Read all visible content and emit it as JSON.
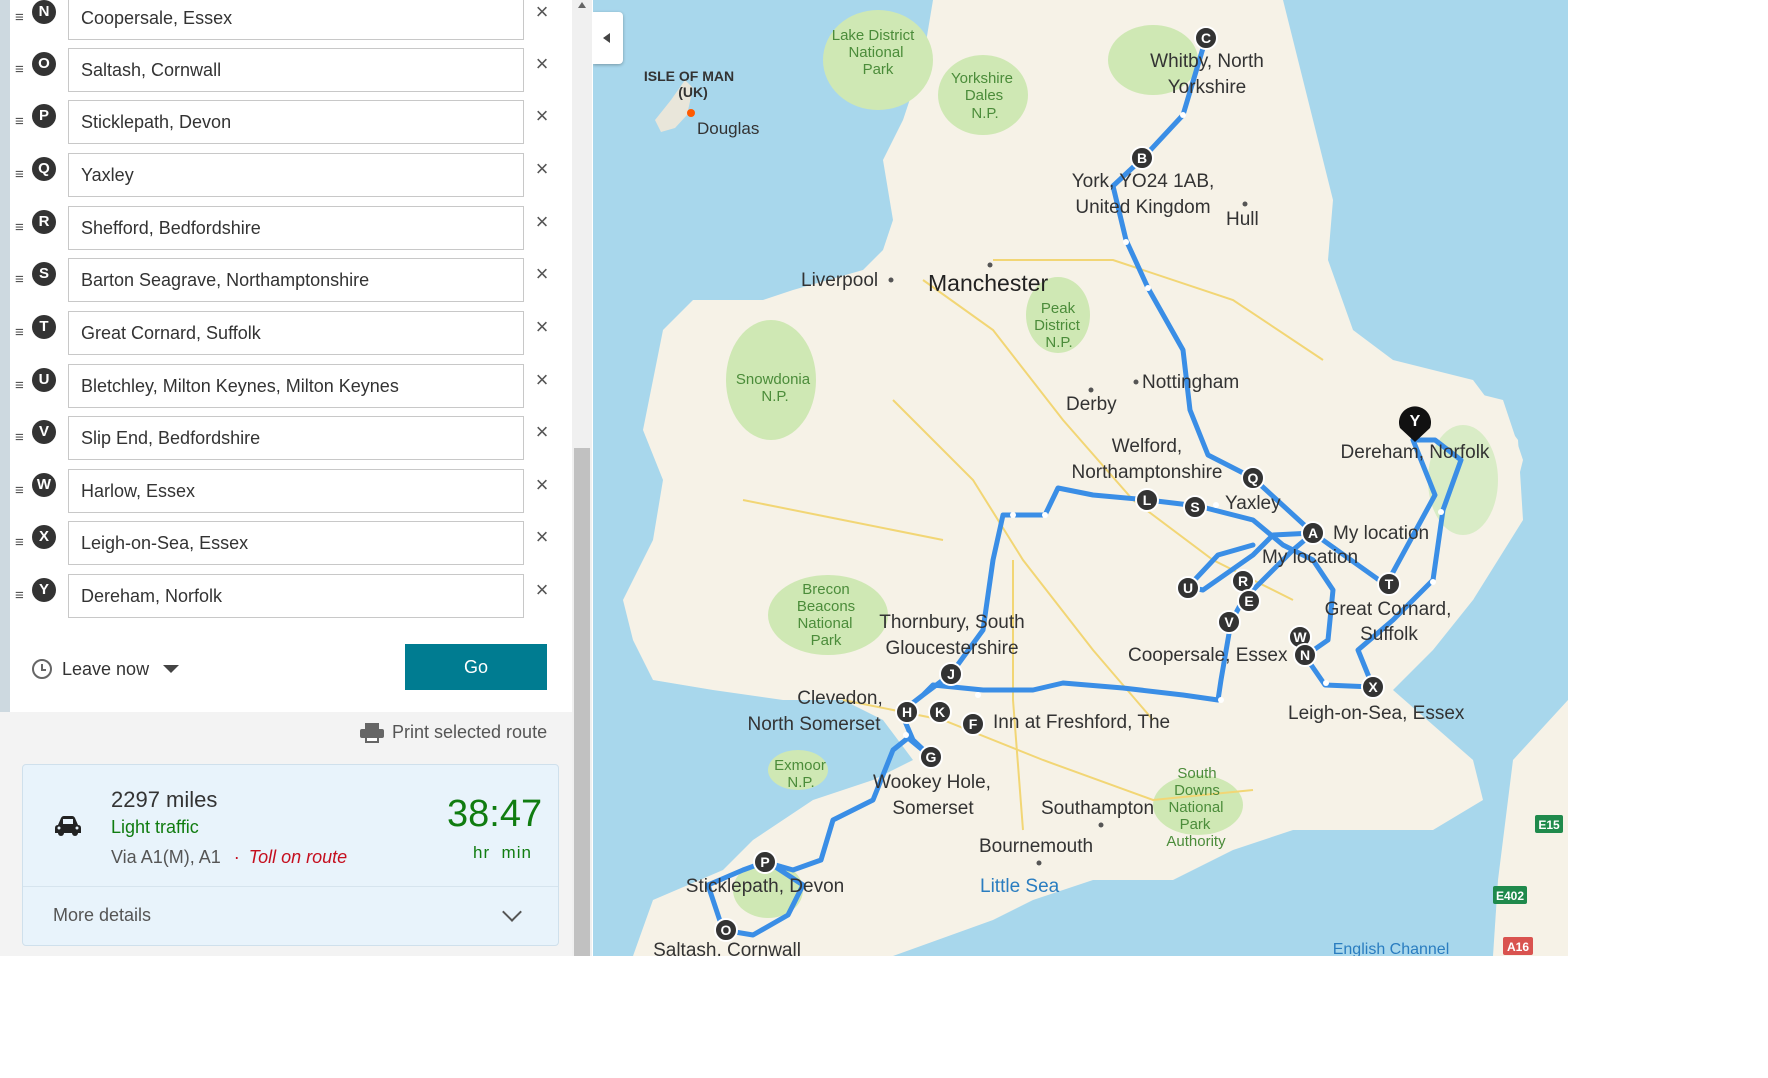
{
  "waypoints": [
    {
      "letter": "N",
      "value": "Coopersale, Essex"
    },
    {
      "letter": "O",
      "value": "Saltash, Cornwall"
    },
    {
      "letter": "P",
      "value": "Sticklepath, Devon"
    },
    {
      "letter": "Q",
      "value": "Yaxley"
    },
    {
      "letter": "R",
      "value": "Shefford, Bedfordshire"
    },
    {
      "letter": "S",
      "value": "Barton Seagrave, Northamptonshire"
    },
    {
      "letter": "T",
      "value": "Great Cornard, Suffolk"
    },
    {
      "letter": "U",
      "value": "Bletchley, Milton Keynes, Milton Keynes"
    },
    {
      "letter": "V",
      "value": "Slip End, Bedfordshire"
    },
    {
      "letter": "W",
      "value": "Harlow, Essex"
    },
    {
      "letter": "X",
      "value": "Leigh-on-Sea, Essex"
    },
    {
      "letter": "Y",
      "value": "Dereham, Norfolk"
    }
  ],
  "remove_glyph": "×",
  "drag_glyph": "≡",
  "leave": {
    "label": "Leave now"
  },
  "go_button": "Go",
  "print_label": "Print selected route",
  "route": {
    "distance": "2297 miles",
    "traffic": "Light traffic",
    "via": "Via A1(M), A1",
    "separator": "·",
    "toll": "Toll on route",
    "duration": "38:47",
    "duration_units": "hr  min",
    "more_details": "More details"
  },
  "map": {
    "stop_labels": {
      "C": "Whitby, North Yorkshire",
      "B": "York, YO24 1AB, United Kingdom",
      "Q": "Yaxley",
      "L": "Welford, Northamptonshire",
      "A": "My location",
      "Y": "Dereham, Norfolk",
      "T": "Great Cornard, Suffolk",
      "N": "Coopersale, Essex",
      "X": "Leigh-on-Sea, Essex",
      "J": "Thornbury, South Gloucestershire",
      "H": "Clevedon, North Somerset",
      "F": "Inn at Freshford, The",
      "G": "Wookey Hole, Somerset",
      "P": "Sticklepath, Devon",
      "O": "Saltash, Cornwall"
    },
    "stop_labels_lines": {
      "whitby": [
        "Whitby, North",
        "Yorkshire"
      ],
      "york": [
        "York, YO24 1AB,",
        "United Kingdom"
      ],
      "welford": [
        "Welford,",
        "Northamptonshire"
      ],
      "cornard": [
        "Great Cornard,",
        "Suffolk"
      ],
      "thornbury": [
        "Thornbury, South",
        "Gloucestershire"
      ],
      "clevedon": [
        "Clevedon,",
        "North Somerset"
      ],
      "wookey": [
        "Wookey Hole,",
        "Somerset"
      ],
      "my_location_2": "My location"
    },
    "places": {
      "isle_of_man": [
        "ISLE OF MAN",
        "(UK)"
      ],
      "douglas": "Douglas",
      "lake_district": [
        "Lake District",
        "National",
        "Park"
      ],
      "yorkshire_dales": [
        "Yorkshire",
        "Dales",
        "N.P."
      ],
      "hull": "Hull",
      "liverpool": "Liverpool",
      "manchester": "Manchester",
      "peak_district": [
        "Peak",
        "District",
        "N.P."
      ],
      "snowdonia": [
        "Snowdonia",
        "N.P."
      ],
      "derby": "Derby",
      "nottingham": "Nottingham",
      "brecon": [
        "Brecon",
        "Beacons",
        "National",
        "Park"
      ],
      "exmoor": [
        "Exmoor",
        "N.P."
      ],
      "southampton": "Southampton",
      "bournemouth": "Bournemouth",
      "little_sea": "Little Sea",
      "south_downs": [
        "South",
        "Downs",
        "National",
        "Park",
        "Authority"
      ],
      "english_channel": "English Channel"
    },
    "road_shields": [
      "E15",
      "E402",
      "A16"
    ],
    "colors": {
      "route": "#3a8ee6",
      "land": "#f6f2e7",
      "water": "#a8d7ec",
      "park": "#cfe8b4",
      "pin": "#333333"
    }
  }
}
